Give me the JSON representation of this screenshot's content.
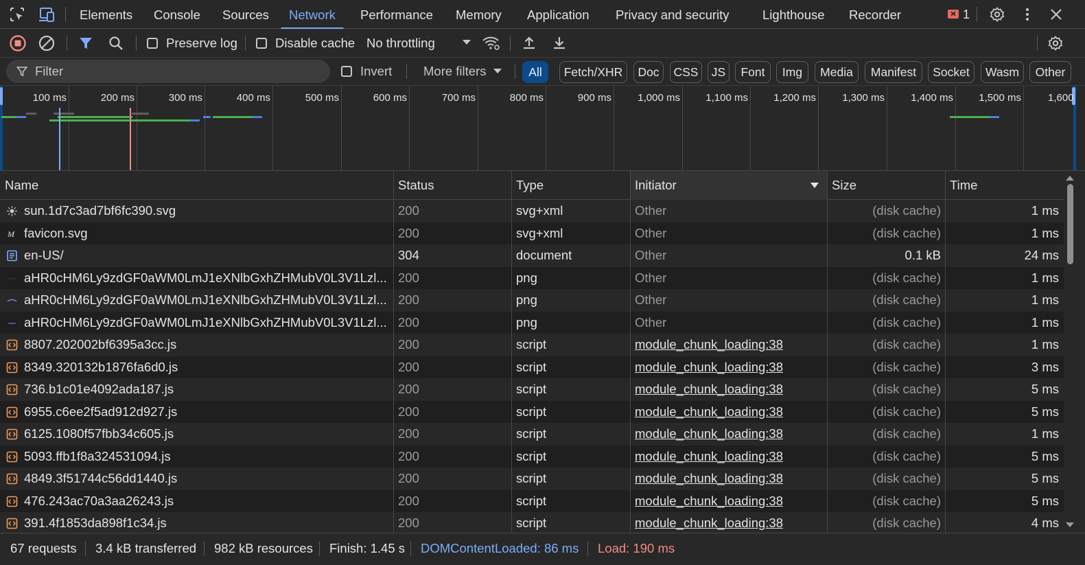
{
  "tabs": [
    {
      "label": "Elements"
    },
    {
      "label": "Console"
    },
    {
      "label": "Sources"
    },
    {
      "label": "Network"
    },
    {
      "label": "Performance"
    },
    {
      "label": "Memory"
    },
    {
      "label": "Application"
    },
    {
      "label": "Privacy and security"
    },
    {
      "label": "Lighthouse"
    },
    {
      "label": "Recorder"
    }
  ],
  "active_tab": "Network",
  "issues_count": "1",
  "toolbar": {
    "preserve_log_label": "Preserve log",
    "disable_cache_label": "Disable cache",
    "throttling_value": "No throttling"
  },
  "filter": {
    "placeholder": "Filter",
    "invert_label": "Invert",
    "more_filters_label": "More filters",
    "chips": [
      "All",
      "Fetch/XHR",
      "Doc",
      "CSS",
      "JS",
      "Font",
      "Img",
      "Media",
      "Manifest",
      "Socket",
      "Wasm",
      "Other"
    ],
    "active_chip": "All"
  },
  "overview": {
    "tick_labels": [
      "100 ms",
      "200 ms",
      "300 ms",
      "400 ms",
      "500 ms",
      "600 ms",
      "700 ms",
      "800 ms",
      "900 ms",
      "1,000 ms",
      "1,100 ms",
      "1,200 ms",
      "1,300 ms",
      "1,400 ms",
      "1,500 ms",
      "1,600"
    ]
  },
  "table": {
    "columns": {
      "name": "Name",
      "status": "Status",
      "type": "Type",
      "initiator": "Initiator",
      "size": "Size",
      "time": "Time"
    },
    "rows": [
      {
        "icon": "sun-svg-icon",
        "name": "sun.1d7c3ad7bf6fc390.svg",
        "status": "200",
        "type": "svg+xml",
        "initiator": "Other",
        "size": "(disk cache)",
        "time": "1 ms"
      },
      {
        "icon": "favicon-svg-icon",
        "name": "favicon.svg",
        "status": "200",
        "type": "svg+xml",
        "initiator": "Other",
        "size": "(disk cache)",
        "time": "1 ms"
      },
      {
        "icon": "document-icon",
        "name": "en-US/",
        "status": "304",
        "type": "document",
        "initiator": "Other",
        "size": "0.1 kB",
        "time": "24 ms"
      },
      {
        "icon": "image-icon",
        "name": "aHR0cHM6Ly9zdGF0aWM0LmJ1eXNlbGxhZHMubV0L3V1Lzl...",
        "status": "200",
        "type": "png",
        "initiator": "Other",
        "size": "(disk cache)",
        "time": "1 ms"
      },
      {
        "icon": "image-icon",
        "name": "aHR0cHM6Ly9zdGF0aWM0LmJ1eXNlbGxhZHMubV0L3V1Lzl...",
        "status": "200",
        "type": "png",
        "initiator": "Other",
        "size": "(disk cache)",
        "time": "1 ms"
      },
      {
        "icon": "image-icon",
        "name": "aHR0cHM6Ly9zdGF0aWM0LmJ1eXNlbGxhZHMubV0L3V1Lzl...",
        "status": "200",
        "type": "png",
        "initiator": "Other",
        "size": "(disk cache)",
        "time": "1 ms"
      },
      {
        "icon": "script-icon",
        "name": "8807.202002bf6395a3cc.js",
        "status": "200",
        "type": "script",
        "initiator": "module_chunk_loading:38",
        "size": "(disk cache)",
        "time": "1 ms"
      },
      {
        "icon": "script-icon",
        "name": "8349.320132b1876fa6d0.js",
        "status": "200",
        "type": "script",
        "initiator": "module_chunk_loading:38",
        "size": "(disk cache)",
        "time": "3 ms"
      },
      {
        "icon": "script-icon",
        "name": "736.b1c01e4092ada187.js",
        "status": "200",
        "type": "script",
        "initiator": "module_chunk_loading:38",
        "size": "(disk cache)",
        "time": "5 ms"
      },
      {
        "icon": "script-icon",
        "name": "6955.c6ee2f5ad912d927.js",
        "status": "200",
        "type": "script",
        "initiator": "module_chunk_loading:38",
        "size": "(disk cache)",
        "time": "5 ms"
      },
      {
        "icon": "script-icon",
        "name": "6125.1080f57fbb34c605.js",
        "status": "200",
        "type": "script",
        "initiator": "module_chunk_loading:38",
        "size": "(disk cache)",
        "time": "1 ms"
      },
      {
        "icon": "script-icon",
        "name": "5093.ffb1f8a324531094.js",
        "status": "200",
        "type": "script",
        "initiator": "module_chunk_loading:38",
        "size": "(disk cache)",
        "time": "5 ms"
      },
      {
        "icon": "script-icon",
        "name": "4849.3f51744c56dd1440.js",
        "status": "200",
        "type": "script",
        "initiator": "module_chunk_loading:38",
        "size": "(disk cache)",
        "time": "5 ms"
      },
      {
        "icon": "script-icon",
        "name": "476.243ac70a3aa26243.js",
        "status": "200",
        "type": "script",
        "initiator": "module_chunk_loading:38",
        "size": "(disk cache)",
        "time": "5 ms"
      },
      {
        "icon": "script-icon",
        "name": "391.4f1853da898f1c34.js",
        "status": "200",
        "type": "script",
        "initiator": "module_chunk_loading:38",
        "size": "(disk cache)",
        "time": "4 ms"
      }
    ]
  },
  "status_bar": {
    "requests": "67 requests",
    "transferred": "3.4 kB transferred",
    "resources": "982 kB resources",
    "finish": "Finish: 1.45 s",
    "dom_content_loaded": "DOMContentLoaded: 86 ms",
    "load": "Load: 190 ms"
  },
  "colors": {
    "accent": "#7cacf8",
    "dom_content_loaded": "#7cacf8",
    "load": "#f28b82",
    "chip_active_bg": "#0b4a8b",
    "record_stop": "#f28b82",
    "issues_badge": "#e46962"
  }
}
